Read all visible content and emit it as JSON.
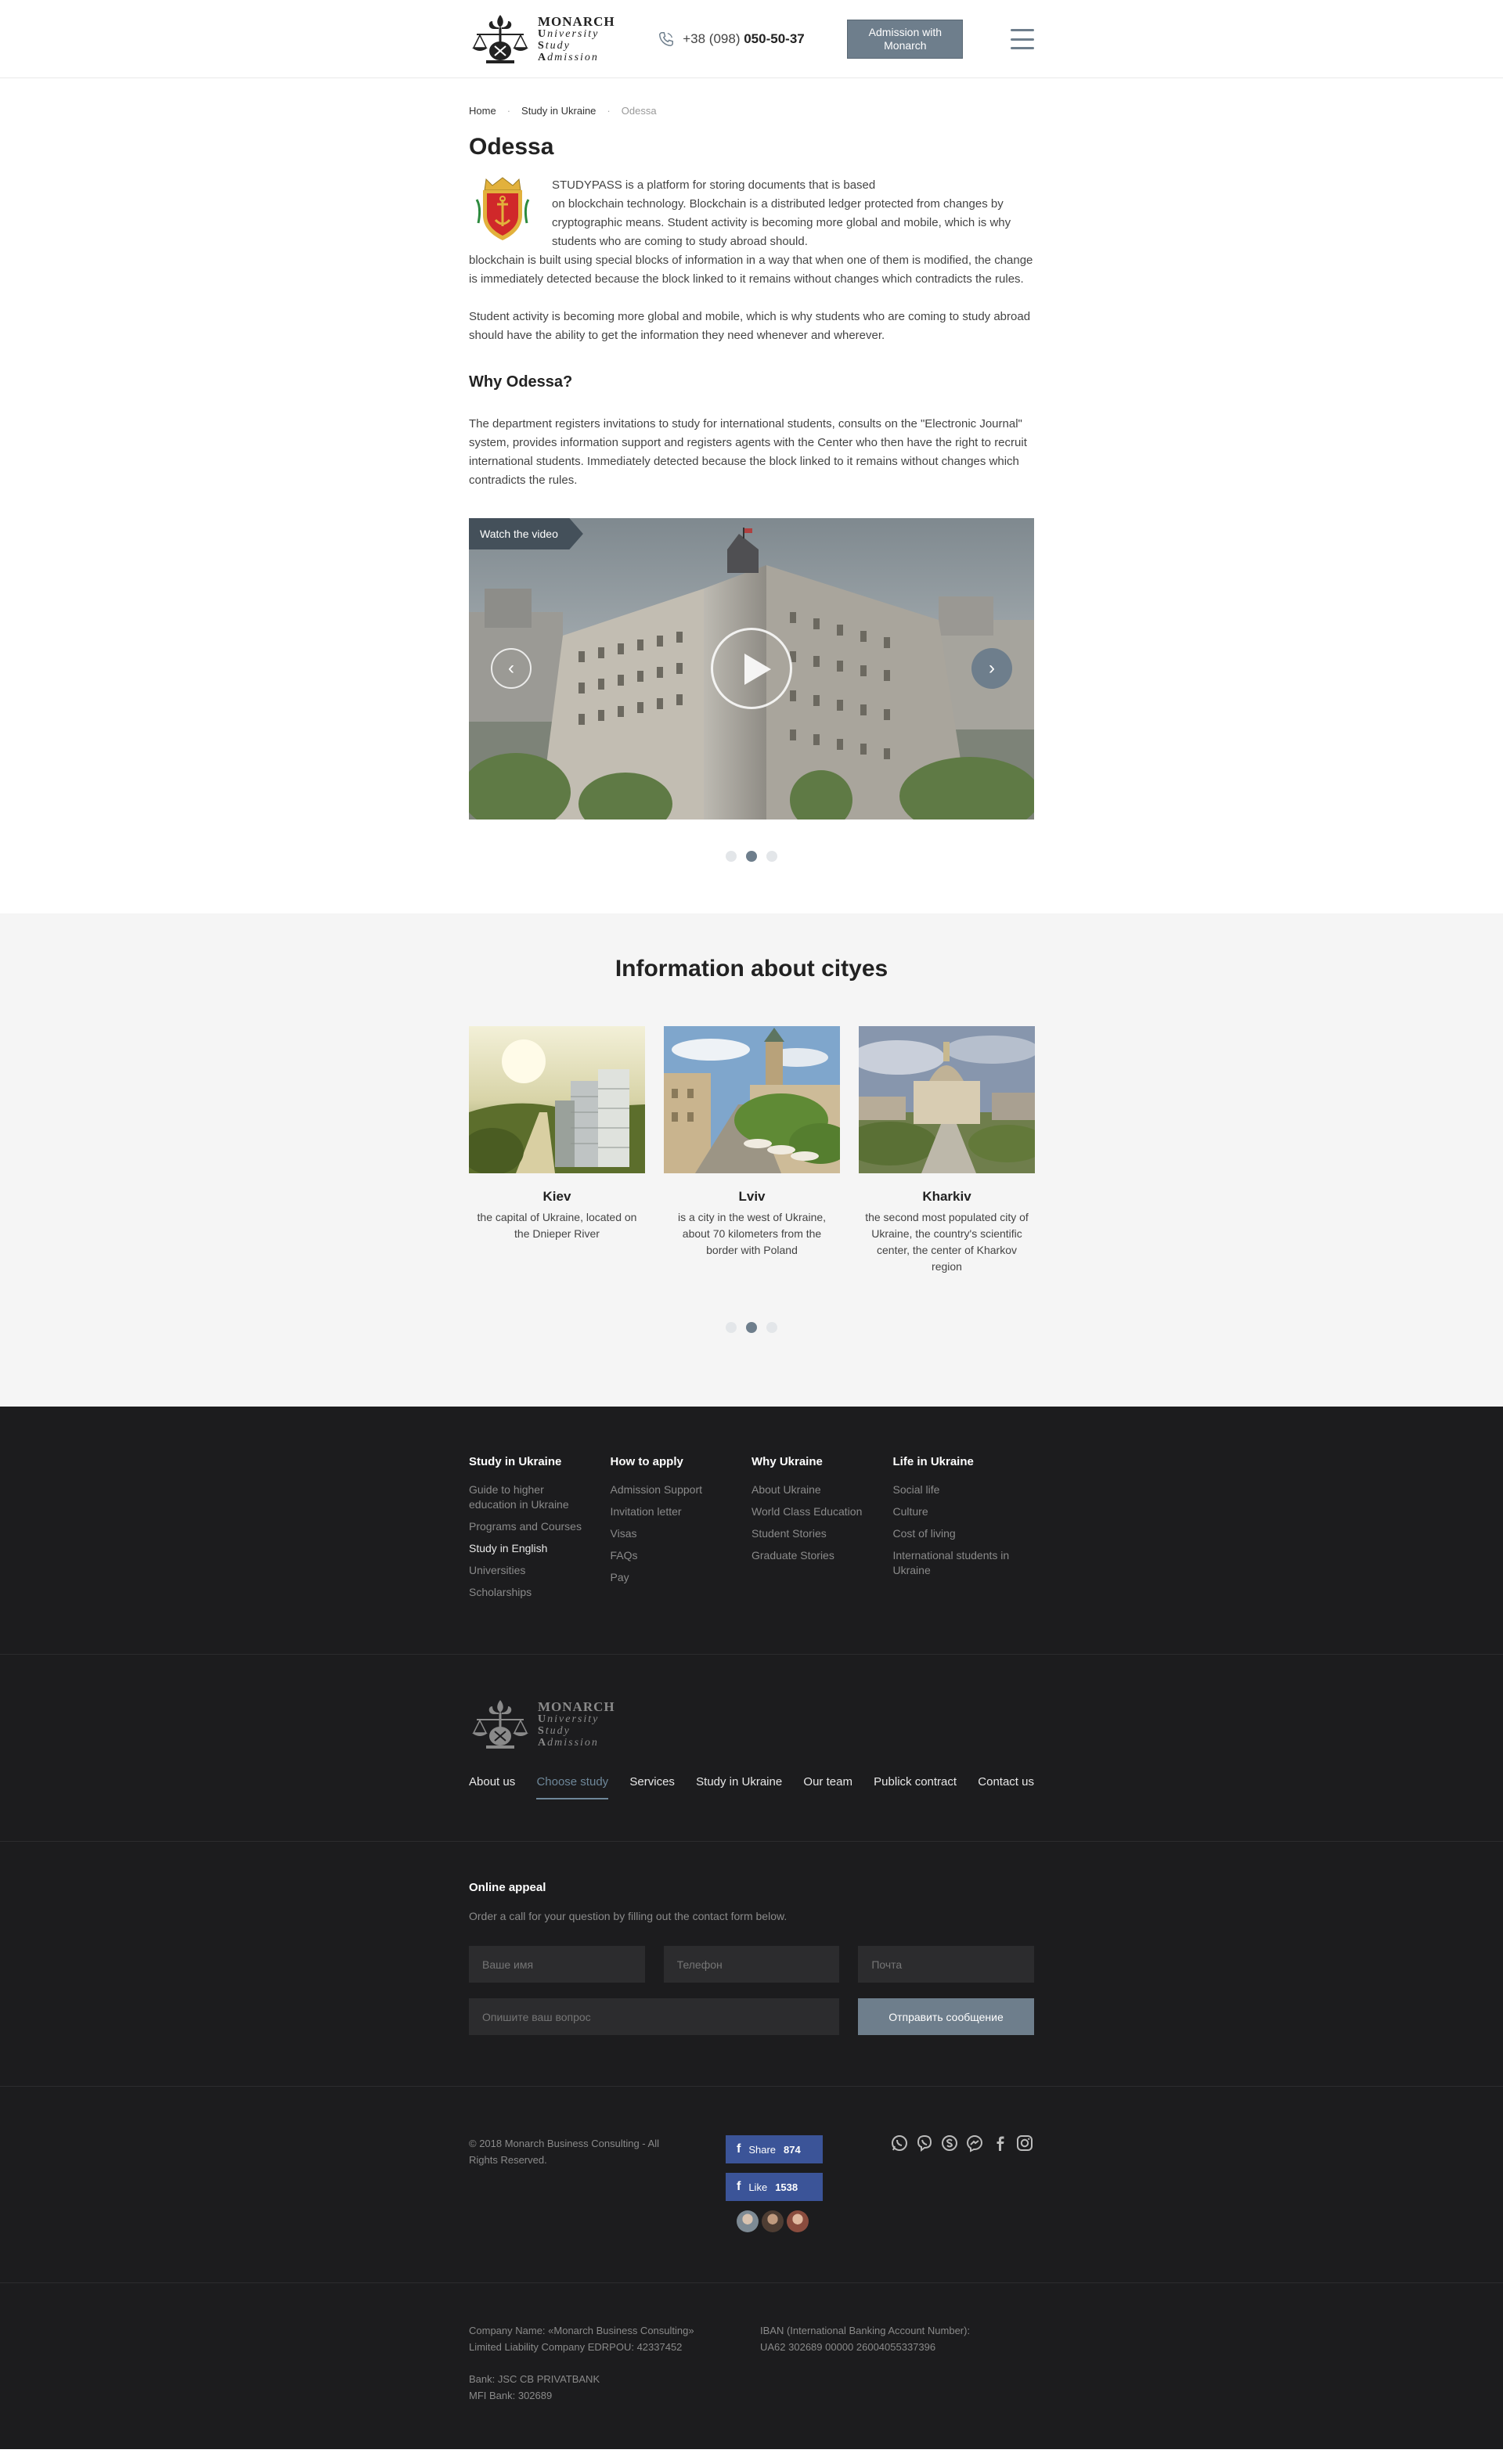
{
  "header": {
    "logo": {
      "brand": "MONARCH",
      "line1_first": "U",
      "line1_rest": "niversity",
      "line2_first": "S",
      "line2_rest": "tudy",
      "line3_first": "A",
      "line3_rest": "dmission"
    },
    "phone_prefix": "+38 (098)",
    "phone_number": "050-50-37",
    "admission_button": "Admission with Monarch"
  },
  "breadcrumb": {
    "items": [
      "Home",
      "Study in Ukraine"
    ],
    "current": "Odessa",
    "separator": "·"
  },
  "page": {
    "title": "Odessa",
    "intro": [
      "STUDYPASS is a platform for storing documents that is based",
      "on blockchain technology. Blockchain is a distributed ledger protected from changes by cryptographic means. Student activity is becoming more global and mobile, which is why students who are coming to study abroad should.",
      "blockchain is built using special blocks of information in a way that when one of them is modified, the change is immediately detected because the block linked to it remains without changes which contradicts the rules."
    ],
    "paragraph2": "Student activity is becoming more global and mobile, which is why students who are coming to study abroad should have the ability to get the information they need whenever and wherever.",
    "why_title": "Why Odessa?",
    "why_text": "The department registers invitations to study for international students, consults on the \"Electronic Journal\" system, provides information support and registers agents with the Center who then have the right to recruit international students. Immediately detected because the block linked to it remains without changes which contradicts the rules.",
    "video_label": "Watch the video",
    "slider_dots": 3,
    "slider_active": 2
  },
  "cities": {
    "title": "Information about cityes",
    "items": [
      {
        "name": "Kiev",
        "desc": "the capital of Ukraine, located on the Dnieper River"
      },
      {
        "name": "Lviv",
        "desc": "is a city in the west of Ukraine, about 70 kilometers from the border with Poland"
      },
      {
        "name": "Kharkiv",
        "desc": "the second most populated city of Ukraine, the country's scientific center, the center of Kharkov region"
      }
    ],
    "slider_active": 2
  },
  "footer": {
    "columns": [
      {
        "title": "Study in Ukraine",
        "links": [
          "Guide to higher education in Ukraine",
          "Programs and Courses",
          "Study in English",
          "Universities",
          "Scholarships"
        ]
      },
      {
        "title": "How to apply",
        "links": [
          "Admission Support",
          "Invitation letter",
          "Visas",
          "FAQs",
          "Pay"
        ]
      },
      {
        "title": "Why Ukraine",
        "links": [
          "About Ukraine",
          "World Class Education",
          "Student Stories",
          "Graduate Stories"
        ]
      },
      {
        "title": "Life in Ukraine",
        "links": [
          "Social life",
          "Culture",
          "Cost of living",
          "International students in Ukraine"
        ]
      }
    ],
    "highlighted_link": "Study in English",
    "nav": [
      "About us",
      "Choose study",
      "Services",
      "Study in Ukraine",
      "Our team",
      "Publick contract",
      "Contact us"
    ],
    "nav_active": "Choose study",
    "appeal": {
      "title": "Online appeal",
      "subtitle": "Order a call for your question by filling out the contact form below.",
      "name_placeholder": "Ваше имя",
      "phone_placeholder": "Телефон",
      "email_placeholder": "Почта",
      "question_placeholder": "Опишите ваш вопрос",
      "send_label": "Отправить сообщение"
    },
    "copyright": "© 2018 Monarch Business Consulting - All Rights Reserved.",
    "fb_share": {
      "label": "Share",
      "count": "874"
    },
    "fb_like": {
      "label": "Like",
      "count": "1538"
    },
    "socials": [
      "whatsapp-icon",
      "viber-icon",
      "skype-icon",
      "messenger-icon",
      "facebook-icon",
      "instagram-icon"
    ],
    "bank": {
      "company_name": "Company Name: «Monarch Business Consulting»",
      "company_edrpou": "Limited Liability Company EDRPOU: 42337452",
      "bank_name": "Bank: JSC CB PRIVATBANK",
      "mfi": "MFI Bank: 302689",
      "iban_label": "IBAN (International Banking Account Number):",
      "iban": "UA62 302689 00000 26004055337396"
    }
  },
  "colors": {
    "accent": "#6e7e8c",
    "footer_bg": "#1c1c1e",
    "facebook": "#3b5498",
    "crest_red": "#d0282a",
    "crest_gold": "#e2b13c"
  }
}
